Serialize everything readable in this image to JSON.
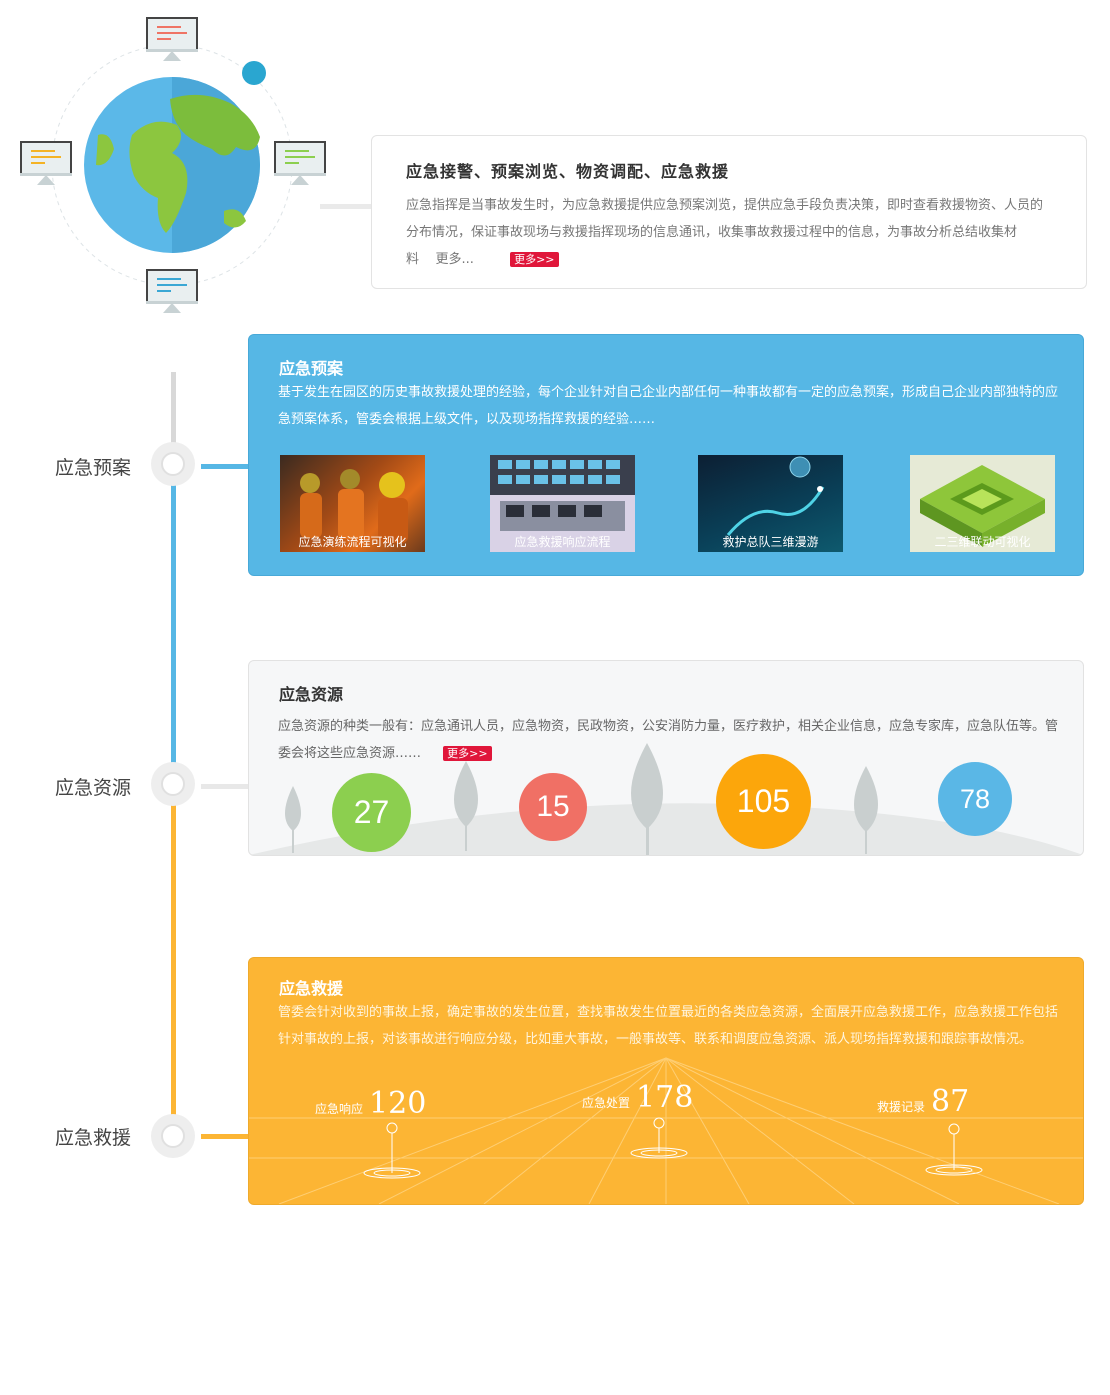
{
  "intro": {
    "title": "应急接警、预案浏览、物资调配、应急救援",
    "body": "应急指挥是当事故发生时，为应急救援提供应急预案浏览，提供应急手段负责决策，即时查看救援物资、人员的分布情况，保证事故现场与救援指挥现场的信息通讯，收集事故救援过程中的信息，为事故分析总结收集材料",
    "more_text": "更多...",
    "more_button": "更多>>"
  },
  "timeline": [
    {
      "label": "应急预案",
      "color": "#56b7e5"
    },
    {
      "label": "应急资源",
      "color": "#e8e8e8"
    },
    {
      "label": "应急救援",
      "color": "#fcb534"
    }
  ],
  "plan": {
    "title": "应急预案",
    "body": "基于发生在园区的历史事故救援处理的经验，每个企业针对自己企业内部任何一种事故都有一定的应急预案，形成自己企业内部独特的应急预案体系，管委会根据上级文件，以及现场指挥救援的经验……",
    "thumbnails": [
      {
        "caption": "应急演练流程可视化"
      },
      {
        "caption": "应急救援响应流程"
      },
      {
        "caption": "救护总队三维漫游"
      },
      {
        "caption": "二三维联动可视化"
      }
    ]
  },
  "resources": {
    "title": "应急资源",
    "body": "应急资源的种类一般有：应急通讯人员，应急物资，民政物资，公安消防力量，医疗救护，相关企业信息，应急专家库，应急队伍等。管委会将这些应急资源……",
    "more_button": "更多>>",
    "counts": [
      {
        "value": "27",
        "color": "#8ccf4f"
      },
      {
        "value": "15",
        "color": "#f07065"
      },
      {
        "value": "105",
        "color": "#fca60b"
      },
      {
        "value": "78",
        "color": "#5ab7e6"
      }
    ]
  },
  "rescue": {
    "title": "应急救援",
    "body": "管委会针对收到的事故上报，确定事故的发生位置，查找事故发生位置最近的各类应急资源，全面展开应急救援工作，应急救援工作包括针对事故的上报，对该事故进行响应分级，比如重大事故，一般事故等、联系和调度应急资源、派人现场指挥救援和跟踪事故情况。",
    "stats": [
      {
        "label": "应急响应",
        "value": "120"
      },
      {
        "label": "应急处置",
        "value": "178"
      },
      {
        "label": "救援记录",
        "value": "87"
      }
    ]
  }
}
